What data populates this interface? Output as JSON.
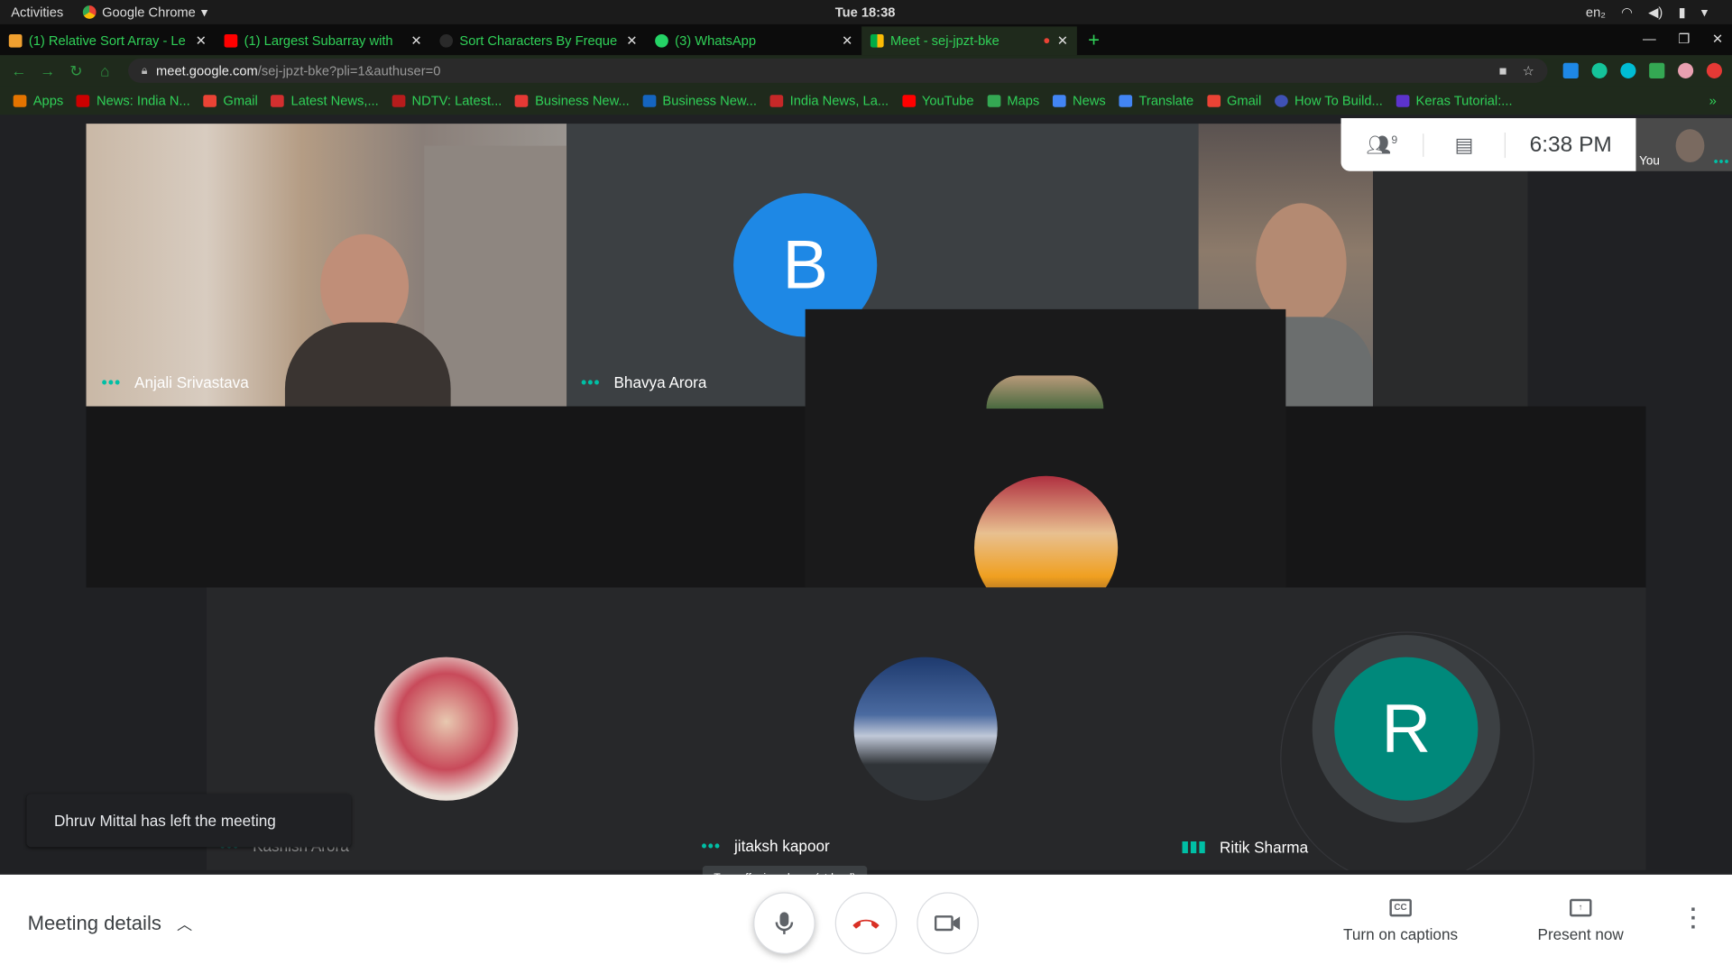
{
  "gnome": {
    "activities": "Activities",
    "app": "Google Chrome",
    "clock": "Tue 18:38",
    "lang": "en₂"
  },
  "tabs": [
    {
      "title": "(1) Relative Sort Array - Le",
      "color": "#f0a030"
    },
    {
      "title": "(1) Largest Subarray with",
      "color": "#ff0000"
    },
    {
      "title": "Sort Characters By Freque",
      "color": "#2a2a2a"
    },
    {
      "title": "(3) WhatsApp",
      "color": "#25d366"
    },
    {
      "title": "Meet - sej-jpzt-bke",
      "color": "#00ac47"
    }
  ],
  "url": {
    "host": "meet.google.com",
    "path": "/sej-jpzt-bke?pli=1&authuser=0"
  },
  "bookmarks": [
    {
      "label": "Apps",
      "color": "#e37400"
    },
    {
      "label": "News: India N...",
      "color": "#cc0000"
    },
    {
      "label": "Gmail",
      "color": "#ea4335"
    },
    {
      "label": "Latest News,...",
      "color": "#d32f2f"
    },
    {
      "label": "NDTV: Latest...",
      "color": "#b71c1c"
    },
    {
      "label": "Business New...",
      "color": "#e53935"
    },
    {
      "label": "Business New...",
      "color": "#1565c0"
    },
    {
      "label": "India News, La...",
      "color": "#c62828"
    },
    {
      "label": "YouTube",
      "color": "#ff0000"
    },
    {
      "label": "Maps",
      "color": "#34a853"
    },
    {
      "label": "News",
      "color": "#4285f4"
    },
    {
      "label": "Translate",
      "color": "#4285f4"
    },
    {
      "label": "Gmail",
      "color": "#ea4335"
    },
    {
      "label": "How To Build...",
      "color": "#3f51b5"
    },
    {
      "label": "Keras Tutorial:...",
      "color": "#5c33cc"
    }
  ],
  "participants": {
    "anjali": "Anjali Srivastava",
    "bhavya": "Bhavya Arora",
    "bhavya_initial": "B",
    "kashish": "Kashish Arora",
    "jitaksh": "jitaksh kapoor",
    "ritik": "Ritik Sharma",
    "ritik_initial": "R"
  },
  "topinfo": {
    "people_count": "9",
    "time": "6:38 PM",
    "you": "You"
  },
  "toast": "Dhruv Mittal has left the meeting",
  "tooltip": "Turn off microphone (ctrl + d)",
  "bottom": {
    "details": "Meeting details",
    "captions": "Turn on captions",
    "cc": "CC",
    "present": "Present now"
  },
  "colors": {
    "bhavya_avatar": "#1e88e5",
    "ritik_avatar": "#00897b",
    "speaking_ring": "#3c4043"
  }
}
